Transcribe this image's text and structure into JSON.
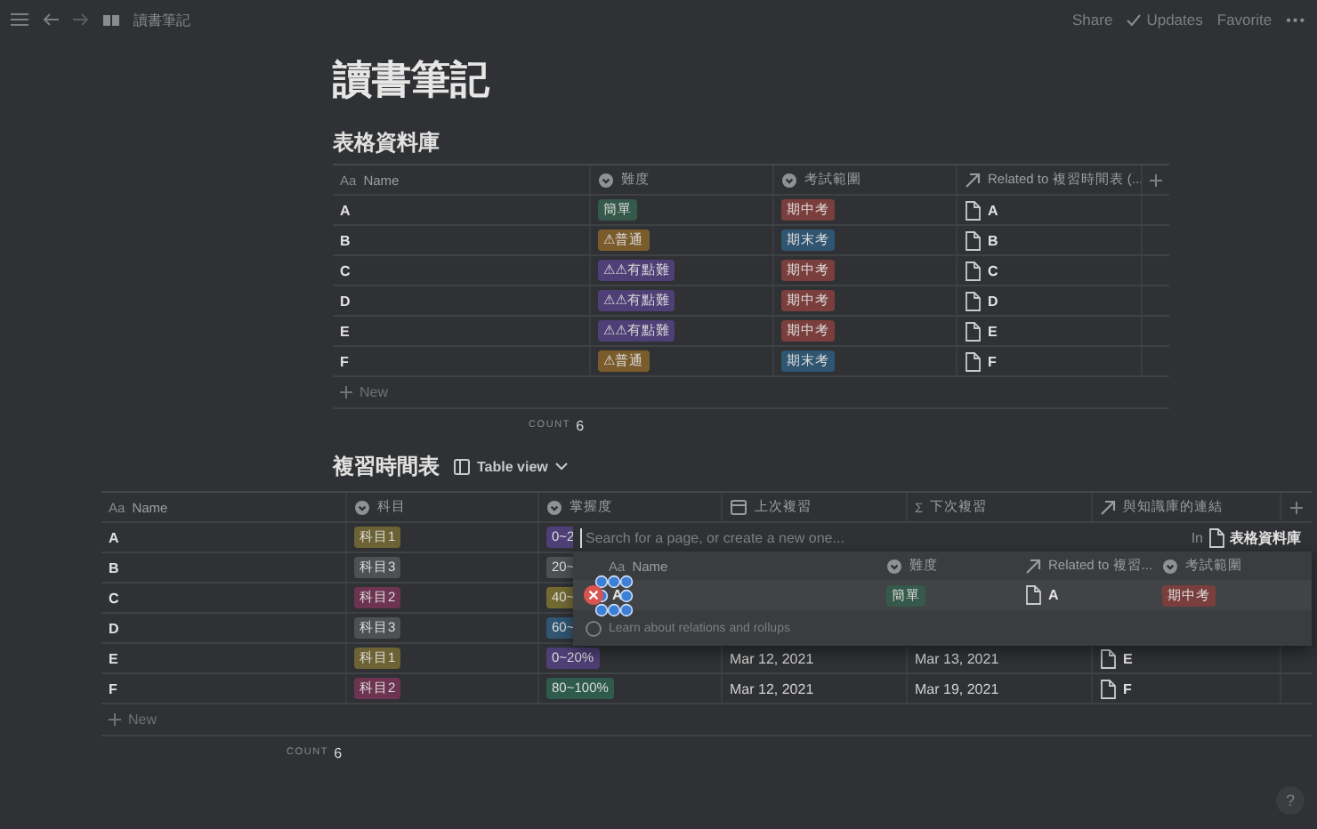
{
  "topbar": {
    "breadcrumb": "讀書筆記",
    "actions": [
      {
        "label": "Share",
        "kind": "text"
      },
      {
        "label": "Updates",
        "kind": "check"
      },
      {
        "label": "Favorite",
        "kind": "text"
      }
    ],
    "more": "•••"
  },
  "title": "讀書筆記",
  "db1": {
    "title": "表格資料庫",
    "columns": [
      {
        "label": "Name",
        "kind": "title",
        "icon_text": "Aa"
      },
      {
        "label": "難度",
        "kind": "select"
      },
      {
        "label": "考試範圍",
        "kind": "select"
      },
      {
        "label": "Related to 複習時間表 (...",
        "kind": "relation"
      }
    ],
    "rows": [
      [
        {
          "kind": "title",
          "text": "A"
        },
        {
          "kind": "tag",
          "text": "簡單",
          "color": "#35594b"
        },
        {
          "kind": "tag",
          "text": "期中考",
          "color": "#7a3f3d"
        },
        {
          "kind": "page",
          "text": "A"
        }
      ],
      [
        {
          "kind": "title",
          "text": "B"
        },
        {
          "kind": "tag",
          "text": "⚠普通",
          "color": "#7a5c2c"
        },
        {
          "kind": "tag",
          "text": "期末考",
          "color": "#2f5571"
        },
        {
          "kind": "page",
          "text": "B"
        }
      ],
      [
        {
          "kind": "title",
          "text": "C"
        },
        {
          "kind": "tag",
          "text": "⚠⚠有點難",
          "color": "#4e3f76"
        },
        {
          "kind": "tag",
          "text": "期中考",
          "color": "#7a3f3d"
        },
        {
          "kind": "page",
          "text": "C"
        }
      ],
      [
        {
          "kind": "title",
          "text": "D"
        },
        {
          "kind": "tag",
          "text": "⚠⚠有點難",
          "color": "#4e3f76"
        },
        {
          "kind": "tag",
          "text": "期中考",
          "color": "#7a3f3d"
        },
        {
          "kind": "page",
          "text": "D"
        }
      ],
      [
        {
          "kind": "title",
          "text": "E"
        },
        {
          "kind": "tag",
          "text": "⚠⚠有點難",
          "color": "#4e3f76"
        },
        {
          "kind": "tag",
          "text": "期中考",
          "color": "#7a3f3d"
        },
        {
          "kind": "page",
          "text": "E"
        }
      ],
      [
        {
          "kind": "title",
          "text": "F"
        },
        {
          "kind": "tag",
          "text": "⚠普通",
          "color": "#7a5c2c"
        },
        {
          "kind": "tag",
          "text": "期末考",
          "color": "#2f5571"
        },
        {
          "kind": "page",
          "text": "F"
        }
      ]
    ],
    "new_label": "New",
    "count_label": "COUNT",
    "count": "6"
  },
  "db2": {
    "title": "複習時間表",
    "view": {
      "label": "Table view"
    },
    "columns": [
      {
        "label": "Name",
        "kind": "title",
        "icon_text": "Aa"
      },
      {
        "label": "科目",
        "kind": "select"
      },
      {
        "label": "掌握度",
        "kind": "select"
      },
      {
        "label": "上次複習",
        "kind": "date"
      },
      {
        "label": "下次複習",
        "kind": "formula",
        "icon_text": "Σ"
      },
      {
        "label": "與知識庫的連結",
        "kind": "relation"
      }
    ],
    "rows": [
      [
        {
          "kind": "title",
          "text": "A"
        },
        {
          "kind": "tag",
          "text": "科目1",
          "color": "#6c6233"
        },
        {
          "kind": "tag",
          "text": "0~2",
          "color": "#4e3f76"
        }
      ],
      [
        {
          "kind": "title",
          "text": "B"
        },
        {
          "kind": "tag",
          "text": "科目3",
          "color": "#4e5154"
        },
        {
          "kind": "tag",
          "text": "20~",
          "color": "#4e5154"
        }
      ],
      [
        {
          "kind": "title",
          "text": "C"
        },
        {
          "kind": "tag",
          "text": "科目2",
          "color": "#6d3452"
        },
        {
          "kind": "tag",
          "text": "40~",
          "color": "#736a33"
        }
      ],
      [
        {
          "kind": "title",
          "text": "D"
        },
        {
          "kind": "tag",
          "text": "科目3",
          "color": "#4e5154"
        },
        {
          "kind": "tag",
          "text": "60~",
          "color": "#2f5571"
        }
      ],
      [
        {
          "kind": "title",
          "text": "E"
        },
        {
          "kind": "tag",
          "text": "科目1",
          "color": "#6c6233"
        },
        {
          "kind": "tag",
          "text": "0~20%",
          "color": "#4e3f76"
        },
        {
          "kind": "plain",
          "text": "Mar 12, 2021"
        },
        {
          "kind": "plain",
          "text": "Mar 13, 2021"
        },
        {
          "kind": "page",
          "text": "E"
        }
      ],
      [
        {
          "kind": "title",
          "text": "F"
        },
        {
          "kind": "tag",
          "text": "科目2",
          "color": "#6d3452"
        },
        {
          "kind": "tag",
          "text": "80~100%",
          "color": "#2e5b4c"
        },
        {
          "kind": "plain",
          "text": "Mar 12, 2021"
        },
        {
          "kind": "plain",
          "text": "Mar 19, 2021"
        },
        {
          "kind": "page",
          "text": "F"
        }
      ]
    ],
    "new_label": "New",
    "count_label": "COUNT",
    "count": "6",
    "relation_popup": {
      "placeholder": "Search for a page, or create a new one...",
      "in_label": "In",
      "database": "表格資料庫",
      "columns": [
        {
          "label": "Name",
          "kind": "title",
          "icon_text": "Aa"
        },
        {
          "label": "難度",
          "kind": "select"
        },
        {
          "label": "Related to 複習...",
          "kind": "relation"
        },
        {
          "label": "考試範圍",
          "kind": "select"
        }
      ],
      "rows": [
        [
          {
            "kind": "title",
            "text": "A"
          },
          {
            "kind": "tag",
            "text": "簡單",
            "color": "#35594b"
          },
          {
            "kind": "page",
            "text": "A"
          },
          {
            "kind": "tag",
            "text": "期中考",
            "color": "#7a3f3d"
          }
        ]
      ],
      "help": "Learn about relations and rollups"
    }
  },
  "help_button": "?"
}
